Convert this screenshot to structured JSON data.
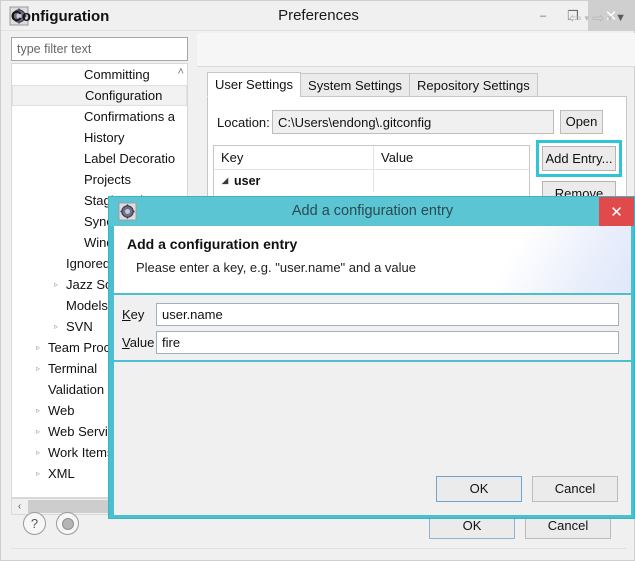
{
  "colors": {
    "dialog_teal": "#4bbfd0",
    "dialog_titlebar_teal": "#5cc5d3",
    "highlight_teal": "#2ec6d6",
    "close_red": "#e04a4a",
    "window_bg": "#f0f0f0"
  },
  "preferences": {
    "title": "Preferences",
    "app_icon": "eclipse-gear-icon",
    "window_controls": {
      "minimize": "–",
      "maximize": "❐",
      "close": "✕"
    },
    "filter": {
      "placeholder": "type filter text",
      "value": ""
    },
    "tree": [
      {
        "label": "Committing",
        "indent": 3,
        "arrow": "",
        "selected": false
      },
      {
        "label": "Configuration",
        "indent": 3,
        "arrow": "",
        "selected": true
      },
      {
        "label": "Confirmations a",
        "indent": 3,
        "arrow": "",
        "selected": false
      },
      {
        "label": "History",
        "indent": 3,
        "arrow": "",
        "selected": false
      },
      {
        "label": "Label Decoratio",
        "indent": 3,
        "arrow": "",
        "selected": false
      },
      {
        "label": "Projects",
        "indent": 3,
        "arrow": "",
        "selected": false
      },
      {
        "label": "Staging View",
        "indent": 3,
        "arrow": "",
        "selected": false
      },
      {
        "label": "Synchronize",
        "indent": 3,
        "arrow": "",
        "selected": false
      },
      {
        "label": "Window Cach",
        "indent": 3,
        "arrow": "",
        "selected": false
      },
      {
        "label": "Ignored",
        "indent": 2,
        "arrow": "",
        "selected": false
      },
      {
        "label": "Jazz Source C",
        "indent": 2,
        "arrow": "▹",
        "selected": false
      },
      {
        "label": "Models",
        "indent": 2,
        "arrow": "",
        "selected": false
      },
      {
        "label": "SVN",
        "indent": 2,
        "arrow": "▹",
        "selected": false
      },
      {
        "label": "Team Process",
        "indent": 1,
        "arrow": "▹",
        "selected": false
      },
      {
        "label": "Terminal",
        "indent": 1,
        "arrow": "▹",
        "selected": false
      },
      {
        "label": "Validation",
        "indent": 1,
        "arrow": "",
        "selected": false
      },
      {
        "label": "Web",
        "indent": 1,
        "arrow": "▹",
        "selected": false
      },
      {
        "label": "Web Services",
        "indent": 1,
        "arrow": "▹",
        "selected": false
      },
      {
        "label": "Work Items",
        "indent": 1,
        "arrow": "▹",
        "selected": false
      },
      {
        "label": "XML",
        "indent": 1,
        "arrow": "▹",
        "selected": false
      }
    ],
    "tree_scroll_up_icon": "˄",
    "hscroll_left_icon": "‹",
    "content": {
      "title": "Configuration",
      "nav": {
        "back_icon": "⇦",
        "back_dropdown_icon": "▾",
        "forward_icon": "⇨",
        "forward_dropdown_icon": "▾",
        "menu_icon": "▼"
      },
      "tabs": [
        {
          "label": "User Settings",
          "active": true
        },
        {
          "label": "System Settings",
          "active": false
        },
        {
          "label": "Repository Settings",
          "active": false
        }
      ],
      "location": {
        "label": "Location:",
        "value": "C:\\Users\\endong\\.gitconfig",
        "open_button": "Open"
      },
      "table": {
        "headers": [
          "Key",
          "Value"
        ],
        "rows": [
          {
            "key": "user",
            "value": "",
            "expand_icon": "◢",
            "bold": true
          }
        ]
      },
      "buttons": {
        "add_entry": "Add Entry...",
        "remove": "Remove"
      }
    },
    "bottom": {
      "help_icon": "?",
      "apply_icon": "restore-defaults-icon",
      "ok": "OK",
      "cancel": "Cancel"
    }
  },
  "dialog": {
    "titlebar_text": "Add a configuration entry",
    "icon": "eclipse-gear-icon",
    "close_icon": "✕",
    "heading": "Add a configuration entry",
    "description": "Please enter a key, e.g. \"user.name\" and a value",
    "fields": [
      {
        "label_prefix": "",
        "label_mnemonic": "K",
        "label_rest": "ey",
        "value": "user.name",
        "name": "key"
      },
      {
        "label_prefix": "",
        "label_mnemonic": "V",
        "label_rest": "alue",
        "value": "fire",
        "name": "value"
      }
    ],
    "buttons": {
      "ok": "OK",
      "cancel": "Cancel"
    }
  }
}
